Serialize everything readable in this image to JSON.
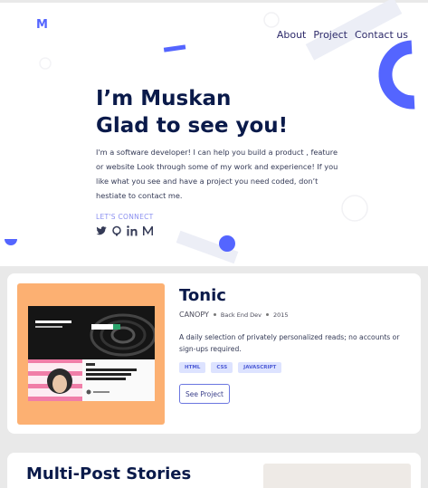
{
  "header": {
    "logo": "M",
    "nav": [
      "About",
      "Project",
      "Contact us"
    ]
  },
  "hero": {
    "title_line1": "I’m Muskan",
    "title_line2": "Glad to see you!",
    "intro": "I'm a software developer! I can help you build a product , feature or website Look through some of my work and experience! If you like what you see and have a project you need coded, don’t hestiate to contact me.",
    "connect_label": "LET'S CONNECT",
    "social_icons": [
      "twitter-icon",
      "github-icon",
      "linkedin-icon",
      "medium-icon"
    ]
  },
  "projects": [
    {
      "title": "Tonic",
      "company": "CANOPY",
      "role": "Back End Dev",
      "year": "2015",
      "description": "A daily selection of privately personalized reads; no accounts or sign-ups required.",
      "tags": [
        "HTML",
        "CSS",
        "JAVASCRIPT"
      ],
      "button": "See Project",
      "thumb_color": "#fcb072"
    },
    {
      "title": "Multi-Post Stories"
    }
  ],
  "colors": {
    "accent": "#5465ff",
    "navy": "#0a1a4a",
    "tag_bg": "#dde3ff"
  }
}
